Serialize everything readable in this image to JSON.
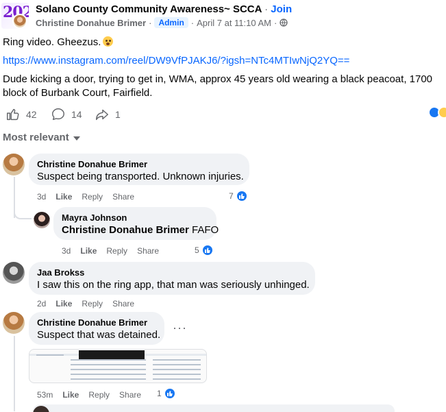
{
  "post": {
    "group_name": "Solano County Community Awareness~ SCCA",
    "separator": "·",
    "join_label": "Join",
    "author": "Christine Donahue Brimer",
    "admin_badge": "Admin",
    "timestamp": "April 7 at 11:10 AM",
    "text_line1": "Ring video. Gheezus.",
    "link": "https://www.instagram.com/reel/DW9VfPJAKJ6/?igsh=NTc4MTIwNjQ2YQ==",
    "description": "Dude kicking a door, trying to get in, WMA, approx 45 years old wearing a black peacoat, 1700 block of Burbank Court, Fairfield.",
    "likes": "42",
    "comments": "14",
    "shares": "1",
    "icons": {
      "like": "thumbs-up-icon",
      "comment": "comment-bubble-icon",
      "share": "share-arrow-icon",
      "privacy": "globe-icon"
    }
  },
  "sort": {
    "label": "Most relevant"
  },
  "comments": [
    {
      "name": "Christine Donahue Brimer",
      "text": "Suspect being transported. Unknown injuries.",
      "time": "3d",
      "like": "Like",
      "reply": "Reply",
      "share": "Share",
      "reactions": "7"
    },
    {
      "name": "Mayra Johnson",
      "mention": "Christine Donahue Brimer",
      "text": " FAFO",
      "time": "3d",
      "like": "Like",
      "reply": "Reply",
      "share": "Share",
      "reactions": "5"
    },
    {
      "name": "Jaa Brokss",
      "text": "I saw this on the ring app, that man was seriously unhinged.",
      "time": "2d",
      "like": "Like",
      "reply": "Reply",
      "share": "Share"
    },
    {
      "name": "Christine Donahue Brimer",
      "text": "Suspect that was detained.",
      "time": "53m",
      "like": "Like",
      "reply": "Reply",
      "share": "Share",
      "reactions": "1",
      "more": "···"
    }
  ],
  "colors": {
    "accent": "#0866ff",
    "like_blue": "#1877f2",
    "muted": "#65676b",
    "bubble": "#f0f2f5"
  }
}
